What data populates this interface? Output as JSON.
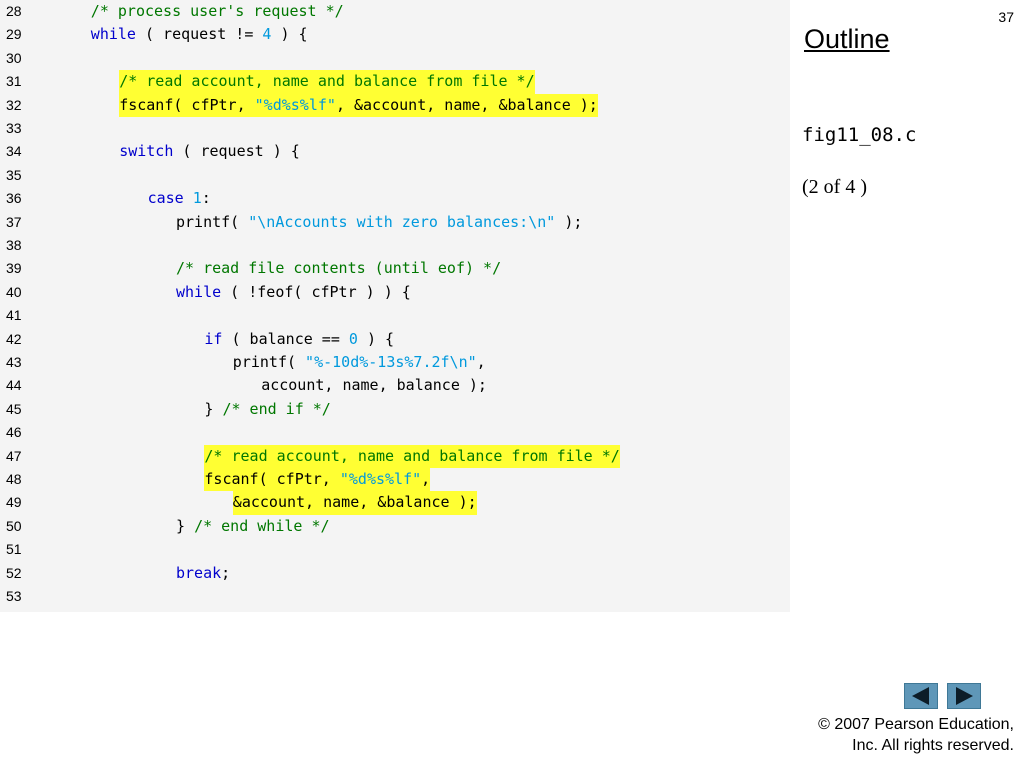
{
  "slide_number": "37",
  "outline_title": "Outline",
  "file_name": "fig11_08.c",
  "page_of": "(2 of 4 )",
  "colors": {
    "keyword": "#0000cc",
    "comment": "#007700",
    "string": "#0099dd",
    "highlight": "#ffff33",
    "code_bg": "#f4f4f4",
    "nav_button": "#5f97b8"
  },
  "nav": {
    "prev_icon": "triangle-left-icon",
    "next_icon": "triangle-right-icon"
  },
  "copyright": {
    "line1": "© 2007 Pearson Education,",
    "line2": "Inc.  All rights reserved."
  },
  "code_lines": [
    {
      "num": "28",
      "indent": 2,
      "segments": [
        {
          "t": "/* process user's request */",
          "c": "cm"
        }
      ]
    },
    {
      "num": "29",
      "indent": 2,
      "segments": [
        {
          "t": "while",
          "c": "kw"
        },
        {
          "t": " ( request != "
        },
        {
          "t": "4",
          "c": "num"
        },
        {
          "t": " ) {"
        }
      ]
    },
    {
      "num": "30",
      "indent": 0,
      "segments": []
    },
    {
      "num": "31",
      "indent": 3,
      "hl": true,
      "segments": [
        {
          "t": "/* read account, name and balance from file */",
          "c": "cm"
        }
      ]
    },
    {
      "num": "32",
      "indent": 3,
      "hl": true,
      "segments": [
        {
          "t": "fscanf( cfPtr, "
        },
        {
          "t": "\"%d%s%lf\"",
          "c": "str"
        },
        {
          "t": ", &account, name, &balance );"
        }
      ]
    },
    {
      "num": "33",
      "indent": 0,
      "segments": []
    },
    {
      "num": "34",
      "indent": 3,
      "segments": [
        {
          "t": "switch",
          "c": "kw"
        },
        {
          "t": " ( request ) {"
        }
      ]
    },
    {
      "num": "35",
      "indent": 0,
      "segments": []
    },
    {
      "num": "36",
      "indent": 4,
      "segments": [
        {
          "t": "case",
          "c": "kw"
        },
        {
          "t": " "
        },
        {
          "t": "1",
          "c": "num"
        },
        {
          "t": ":"
        }
      ]
    },
    {
      "num": "37",
      "indent": 5,
      "segments": [
        {
          "t": "printf( "
        },
        {
          "t": "\"\\nAccounts with zero balances:\\n\"",
          "c": "str"
        },
        {
          "t": " );"
        }
      ]
    },
    {
      "num": "38",
      "indent": 0,
      "segments": []
    },
    {
      "num": "39",
      "indent": 5,
      "segments": [
        {
          "t": "/* read file contents (until eof) */",
          "c": "cm"
        }
      ]
    },
    {
      "num": "40",
      "indent": 5,
      "segments": [
        {
          "t": "while",
          "c": "kw"
        },
        {
          "t": " ( !feof( cfPtr ) ) {"
        }
      ]
    },
    {
      "num": "41",
      "indent": 0,
      "segments": []
    },
    {
      "num": "42",
      "indent": 6,
      "segments": [
        {
          "t": "if",
          "c": "kw"
        },
        {
          "t": " ( balance == "
        },
        {
          "t": "0",
          "c": "num"
        },
        {
          "t": " ) {"
        }
      ]
    },
    {
      "num": "43",
      "indent": 7,
      "segments": [
        {
          "t": "printf( "
        },
        {
          "t": "\"%-10d%-13s%7.2f\\n\"",
          "c": "str"
        },
        {
          "t": ","
        }
      ]
    },
    {
      "num": "44",
      "indent": 8,
      "segments": [
        {
          "t": "account, name, balance );"
        }
      ]
    },
    {
      "num": "45",
      "indent": 6,
      "segments": [
        {
          "t": "} "
        },
        {
          "t": "/* end if */",
          "c": "cm"
        }
      ]
    },
    {
      "num": "46",
      "indent": 0,
      "segments": []
    },
    {
      "num": "47",
      "indent": 6,
      "hl": true,
      "segments": [
        {
          "t": "/* read account, name and balance from file */",
          "c": "cm"
        }
      ]
    },
    {
      "num": "48",
      "indent": 6,
      "hl": true,
      "segments": [
        {
          "t": "fscanf( cfPtr, "
        },
        {
          "t": "\"%d%s%lf\"",
          "c": "str"
        },
        {
          "t": ","
        }
      ]
    },
    {
      "num": "49",
      "indent": 7,
      "hl": true,
      "segments": [
        {
          "t": "&account, name, &balance );"
        }
      ]
    },
    {
      "num": "50",
      "indent": 5,
      "segments": [
        {
          "t": "} "
        },
        {
          "t": "/* end while */",
          "c": "cm"
        }
      ]
    },
    {
      "num": "51",
      "indent": 0,
      "segments": []
    },
    {
      "num": "52",
      "indent": 5,
      "segments": [
        {
          "t": "break",
          "c": "kw"
        },
        {
          "t": ";"
        }
      ]
    },
    {
      "num": "53",
      "indent": 0,
      "segments": []
    }
  ]
}
